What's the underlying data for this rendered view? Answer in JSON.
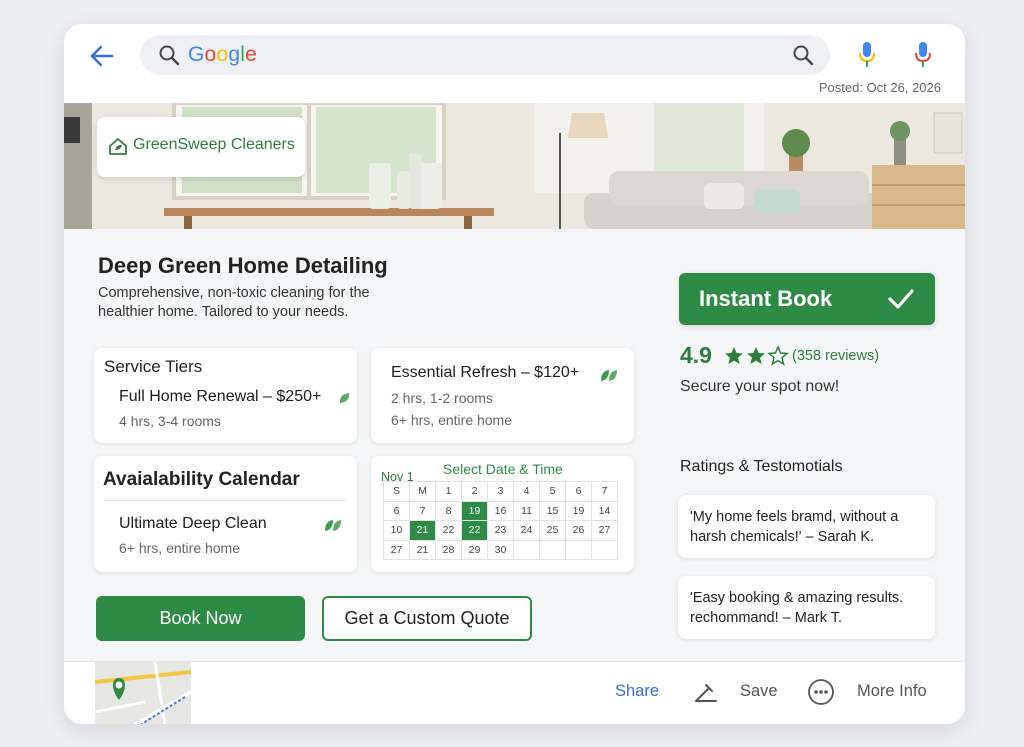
{
  "search": {
    "brand_letters": [
      "G",
      "o",
      "o",
      "g",
      "l",
      "e"
    ],
    "brand_colors": [
      "#4285F4",
      "#EA4335",
      "#FBBC05",
      "#4285F4",
      "#34A853",
      "#EA4335"
    ]
  },
  "posted": "Posted: Oct 26, 2026",
  "logo": {
    "name": "GreenSweep Cleaners"
  },
  "service": {
    "title": "Deep Green Home Detailing",
    "subtitle": "Comprehensive, non-toxic cleaning for the healthier home. Tailored to your needs."
  },
  "tiers": {
    "heading": "Service Tiers",
    "items": [
      {
        "name": "Full Home Renewal – $250+",
        "detail": "4 hrs, 3-4 rooms"
      },
      {
        "name": "Essential Refresh – $120+",
        "detail": "2 hrs, 1-2 rooms",
        "detail2": "6+ hrs, entire home"
      },
      {
        "name": "Ultimate Deep Clean",
        "detail": "6+ hrs, entire home"
      }
    ]
  },
  "availability": {
    "heading": "Avaialability Calendar"
  },
  "calendar": {
    "month": "Nov 1",
    "title": "Select Date & Time",
    "rows": [
      [
        "S",
        "M",
        "1",
        "2",
        "3",
        "4",
        "5",
        "6",
        "7"
      ],
      [
        "6",
        "7",
        "8",
        "19",
        "16",
        "11",
        "15",
        "19",
        "14"
      ],
      [
        "10",
        "21",
        "22",
        "22",
        "23",
        "24",
        "25",
        "26",
        "27"
      ],
      [
        "27",
        "21",
        "28",
        "29",
        "30",
        "",
        "",
        "",
        ""
      ]
    ],
    "highlighted": [
      "1-3",
      "2-1",
      "2-3"
    ]
  },
  "actions": {
    "book_now": "Book Now",
    "custom_quote": "Get a Custom Quote"
  },
  "booking": {
    "instant": "Instant Book",
    "rating": "4.9",
    "stars": 3.5,
    "reviews": "(358 reviews)",
    "secure": "Secure your spot now!"
  },
  "testimonials": {
    "heading": "Ratings & Testomotials",
    "items": [
      "'My home feels bramd, without a harsh chemicals!' – Sarah K.",
      "'Easy booking & amazing results. rechommand! – Mark T."
    ]
  },
  "footer": {
    "share": "Share",
    "save": "Save",
    "more": "More Info"
  },
  "colors": {
    "accent": "#2e8b46",
    "link": "#3a6fd8"
  }
}
